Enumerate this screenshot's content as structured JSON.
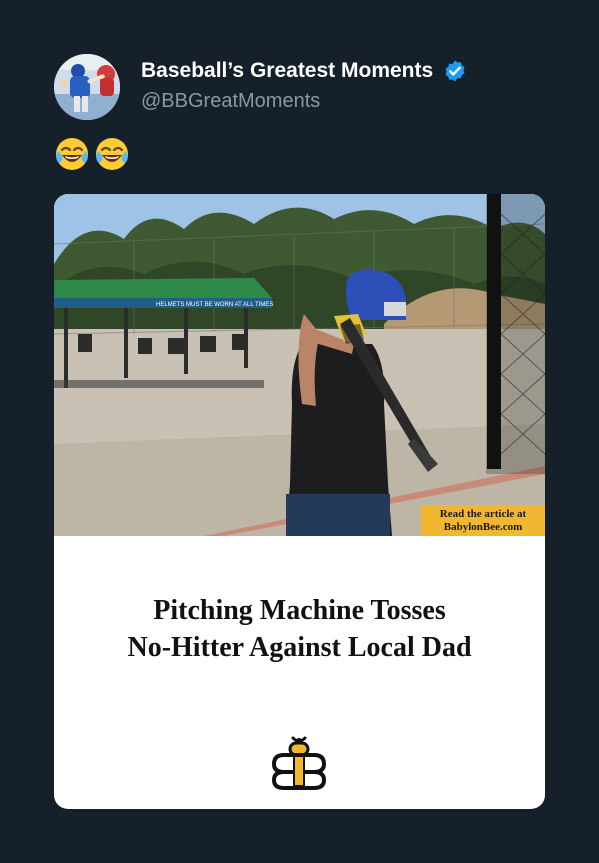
{
  "tweet": {
    "author": {
      "display_name": "Baseball’s Greatest Moments",
      "handle": "@BBGreatMoments",
      "verified": true,
      "avatar_icon": "baseball-player-avatar"
    },
    "body": {
      "emojis": [
        "😂",
        "😂"
      ],
      "emoji_icon": "face-with-tears-of-joy-icon"
    },
    "card": {
      "photo": "batter-at-batting-cage-photo",
      "cta_line1": "Read the article at",
      "cta_line2": "BabylonBee.com",
      "cta_color": "#f2b731",
      "sign_text": "HELMETS MUST BE WORN AT ALL TIMES",
      "headline_line1": "Pitching Machine Tosses",
      "headline_line2": "No-Hitter Against Local Dad",
      "logo_icon": "babylon-bee-logo-icon"
    }
  },
  "colors": {
    "background": "#15202b",
    "secondary_text": "#8899a6",
    "verified_badge": "#1d9bf0",
    "card_background": "#ffffff",
    "headline_text": "#111111",
    "logo_gold": "#f2b731"
  }
}
